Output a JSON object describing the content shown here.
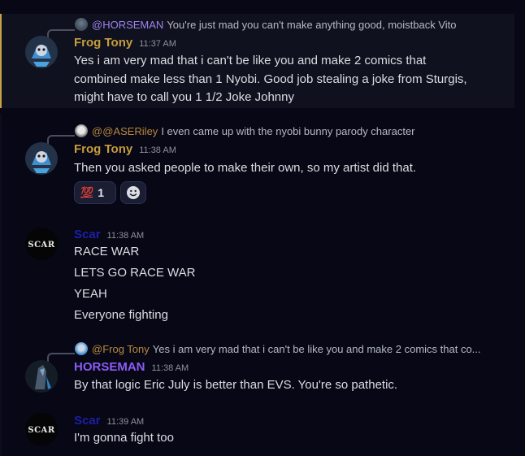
{
  "colors": {
    "background": "#070716",
    "highlight": "#10111f",
    "highlight_bar": "#c7a246",
    "frog_tony": "#c69e3c",
    "horseman": "#8a5cf5",
    "scar": "#1d1fa8",
    "ase_riley": "#b88a3d",
    "mention_purple": "#9b84ec"
  },
  "messages": [
    {
      "reply": {
        "icon": "horseman-mini-avatar",
        "mention": "@HORSEMAN",
        "preview": "You're just mad you can't make anything good, moistback Vito"
      },
      "author": "Frog Tony",
      "timestamp": "11:37 AM",
      "avatar": "frog-tony-avatar",
      "lines": [
        "Yes i am very mad that i can't be like you and make 2 comics that",
        "combined make less than 1 Nyobi. Good job stealing a joke from Sturgis,",
        "might have to call you 1 1/2 Joke Johnny"
      ]
    },
    {
      "reply": {
        "icon": "ase-riley-mini-avatar",
        "mention": "@@ASERiley",
        "preview": "I even came up with the nyobi bunny parody character"
      },
      "author": "Frog Tony",
      "timestamp": "11:38 AM",
      "avatar": "frog-tony-avatar",
      "lines": [
        "Then you asked people to make their own, so my artist did that."
      ],
      "reactions": [
        {
          "emoji": "💯",
          "count": "1"
        }
      ],
      "add_reaction_icon": "add-reaction-icon"
    },
    {
      "author": "Scar",
      "timestamp": "11:38 AM",
      "avatar": "scar-avatar",
      "avatar_text": "SCAR",
      "lines": [
        "RACE WAR",
        "LETS GO RACE WAR",
        "YEAH",
        "Everyone fighting"
      ]
    },
    {
      "reply": {
        "icon": "frog-tony-mini-avatar",
        "mention": "@Frog Tony",
        "preview": "Yes i am very mad that i can't be like you and make 2 comics that co..."
      },
      "author": "HORSEMAN",
      "timestamp": "11:38 AM",
      "avatar": "horseman-avatar",
      "lines": [
        "By that logic Eric July is better than EVS. You're so pathetic."
      ]
    },
    {
      "author": "Scar",
      "timestamp": "11:39 AM",
      "avatar": "scar-avatar",
      "avatar_text": "SCAR",
      "lines": [
        "I'm gonna fight too"
      ]
    }
  ]
}
